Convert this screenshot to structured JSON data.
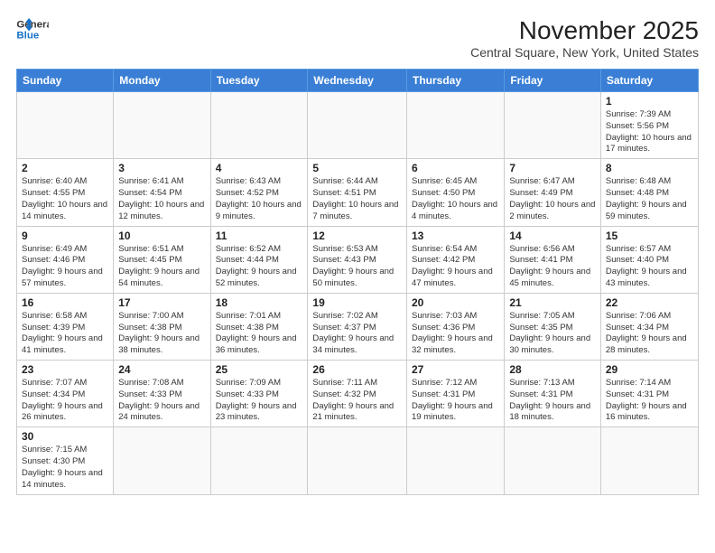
{
  "header": {
    "logo_line1": "General",
    "logo_line2": "Blue",
    "month_title": "November 2025",
    "location": "Central Square, New York, United States"
  },
  "days_of_week": [
    "Sunday",
    "Monday",
    "Tuesday",
    "Wednesday",
    "Thursday",
    "Friday",
    "Saturday"
  ],
  "weeks": [
    [
      {
        "day": "",
        "info": ""
      },
      {
        "day": "",
        "info": ""
      },
      {
        "day": "",
        "info": ""
      },
      {
        "day": "",
        "info": ""
      },
      {
        "day": "",
        "info": ""
      },
      {
        "day": "",
        "info": ""
      },
      {
        "day": "1",
        "info": "Sunrise: 7:39 AM\nSunset: 5:56 PM\nDaylight: 10 hours and 17 minutes."
      }
    ],
    [
      {
        "day": "2",
        "info": "Sunrise: 6:40 AM\nSunset: 4:55 PM\nDaylight: 10 hours and 14 minutes."
      },
      {
        "day": "3",
        "info": "Sunrise: 6:41 AM\nSunset: 4:54 PM\nDaylight: 10 hours and 12 minutes."
      },
      {
        "day": "4",
        "info": "Sunrise: 6:43 AM\nSunset: 4:52 PM\nDaylight: 10 hours and 9 minutes."
      },
      {
        "day": "5",
        "info": "Sunrise: 6:44 AM\nSunset: 4:51 PM\nDaylight: 10 hours and 7 minutes."
      },
      {
        "day": "6",
        "info": "Sunrise: 6:45 AM\nSunset: 4:50 PM\nDaylight: 10 hours and 4 minutes."
      },
      {
        "day": "7",
        "info": "Sunrise: 6:47 AM\nSunset: 4:49 PM\nDaylight: 10 hours and 2 minutes."
      },
      {
        "day": "8",
        "info": "Sunrise: 6:48 AM\nSunset: 4:48 PM\nDaylight: 9 hours and 59 minutes."
      }
    ],
    [
      {
        "day": "9",
        "info": "Sunrise: 6:49 AM\nSunset: 4:46 PM\nDaylight: 9 hours and 57 minutes."
      },
      {
        "day": "10",
        "info": "Sunrise: 6:51 AM\nSunset: 4:45 PM\nDaylight: 9 hours and 54 minutes."
      },
      {
        "day": "11",
        "info": "Sunrise: 6:52 AM\nSunset: 4:44 PM\nDaylight: 9 hours and 52 minutes."
      },
      {
        "day": "12",
        "info": "Sunrise: 6:53 AM\nSunset: 4:43 PM\nDaylight: 9 hours and 50 minutes."
      },
      {
        "day": "13",
        "info": "Sunrise: 6:54 AM\nSunset: 4:42 PM\nDaylight: 9 hours and 47 minutes."
      },
      {
        "day": "14",
        "info": "Sunrise: 6:56 AM\nSunset: 4:41 PM\nDaylight: 9 hours and 45 minutes."
      },
      {
        "day": "15",
        "info": "Sunrise: 6:57 AM\nSunset: 4:40 PM\nDaylight: 9 hours and 43 minutes."
      }
    ],
    [
      {
        "day": "16",
        "info": "Sunrise: 6:58 AM\nSunset: 4:39 PM\nDaylight: 9 hours and 41 minutes."
      },
      {
        "day": "17",
        "info": "Sunrise: 7:00 AM\nSunset: 4:38 PM\nDaylight: 9 hours and 38 minutes."
      },
      {
        "day": "18",
        "info": "Sunrise: 7:01 AM\nSunset: 4:38 PM\nDaylight: 9 hours and 36 minutes."
      },
      {
        "day": "19",
        "info": "Sunrise: 7:02 AM\nSunset: 4:37 PM\nDaylight: 9 hours and 34 minutes."
      },
      {
        "day": "20",
        "info": "Sunrise: 7:03 AM\nSunset: 4:36 PM\nDaylight: 9 hours and 32 minutes."
      },
      {
        "day": "21",
        "info": "Sunrise: 7:05 AM\nSunset: 4:35 PM\nDaylight: 9 hours and 30 minutes."
      },
      {
        "day": "22",
        "info": "Sunrise: 7:06 AM\nSunset: 4:34 PM\nDaylight: 9 hours and 28 minutes."
      }
    ],
    [
      {
        "day": "23",
        "info": "Sunrise: 7:07 AM\nSunset: 4:34 PM\nDaylight: 9 hours and 26 minutes."
      },
      {
        "day": "24",
        "info": "Sunrise: 7:08 AM\nSunset: 4:33 PM\nDaylight: 9 hours and 24 minutes."
      },
      {
        "day": "25",
        "info": "Sunrise: 7:09 AM\nSunset: 4:33 PM\nDaylight: 9 hours and 23 minutes."
      },
      {
        "day": "26",
        "info": "Sunrise: 7:11 AM\nSunset: 4:32 PM\nDaylight: 9 hours and 21 minutes."
      },
      {
        "day": "27",
        "info": "Sunrise: 7:12 AM\nSunset: 4:31 PM\nDaylight: 9 hours and 19 minutes."
      },
      {
        "day": "28",
        "info": "Sunrise: 7:13 AM\nSunset: 4:31 PM\nDaylight: 9 hours and 18 minutes."
      },
      {
        "day": "29",
        "info": "Sunrise: 7:14 AM\nSunset: 4:31 PM\nDaylight: 9 hours and 16 minutes."
      }
    ],
    [
      {
        "day": "30",
        "info": "Sunrise: 7:15 AM\nSunset: 4:30 PM\nDaylight: 9 hours and 14 minutes."
      },
      {
        "day": "",
        "info": ""
      },
      {
        "day": "",
        "info": ""
      },
      {
        "day": "",
        "info": ""
      },
      {
        "day": "",
        "info": ""
      },
      {
        "day": "",
        "info": ""
      },
      {
        "day": "",
        "info": ""
      }
    ]
  ]
}
